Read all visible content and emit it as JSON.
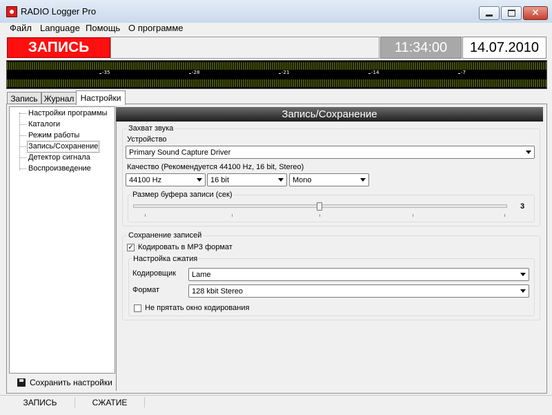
{
  "window": {
    "title": "RADIO Logger Pro"
  },
  "menu": [
    "Файл",
    "Language",
    "Помощь",
    "О программе"
  ],
  "status": {
    "record_label": "ЗАПИСЬ",
    "time": "11:34:00",
    "date": "14.07.2010"
  },
  "meter": {
    "ticks": [
      "-35",
      "-28",
      "-21",
      "-14",
      "-7"
    ],
    "color_bar": "#4b5a0c"
  },
  "tabs": [
    "Запись",
    "Журнал",
    "Настройки"
  ],
  "tabs_active": "Настройки",
  "tree": {
    "items": [
      "Настройки программы",
      "Каталоги",
      "Режим работы",
      "Запись/Сохранение",
      "Детектор сигнала",
      "Воспроизведение"
    ],
    "selected": "Запись/Сохранение"
  },
  "save_button": {
    "label": "Сохранить настройки",
    "icon": "floppy-disk-icon"
  },
  "section": {
    "title": "Запись/Сохранение",
    "capture": {
      "group_title": "Захват звука",
      "device_label": "Устройство",
      "device_value": "Primary Sound Capture Driver",
      "quality_label": "Качество (Рекомендуется 44100 Hz, 16 bit, Stereo)",
      "sample_rate": "44100 Hz",
      "bit_depth": "16 bit",
      "channels": "Mono",
      "buffer_label": "Размер буфера записи (сек)",
      "buffer_value": "3"
    },
    "save": {
      "group_title": "Сохранение записей",
      "mp3_label": "Кодировать в MP3 формат",
      "mp3_checked": true,
      "compression_title": "Настройка сжатия",
      "encoder_label": "Кодировщик",
      "encoder_value": "Lame",
      "format_label": "Формат",
      "format_value": "128 kbit Stereo",
      "hide_label": "Не прятать окно кодирования",
      "hide_checked": false
    }
  },
  "statusbar": [
    "ЗАПИСЬ",
    "СЖАТИЕ"
  ],
  "colors": {
    "record_red": "#ff0f0f",
    "time_bg": "#a8a8a8",
    "header_dark": "#1f1f1f"
  }
}
